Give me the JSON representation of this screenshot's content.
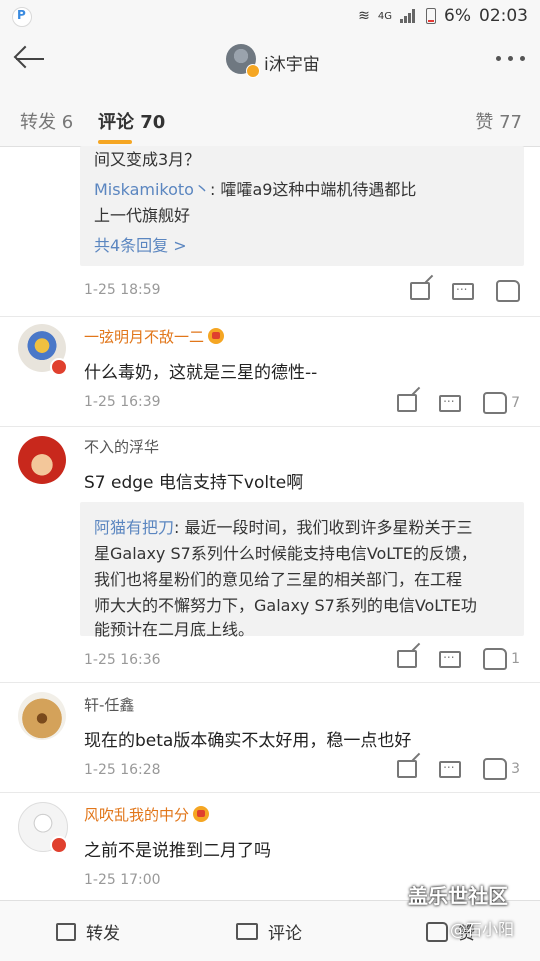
{
  "status_bar": {
    "network": "4G",
    "battery": "6%",
    "time": "02:03"
  },
  "header": {
    "title": "i沐宇宙"
  },
  "tabs": [
    {
      "label": "转发 6"
    },
    {
      "label": "评论 70"
    },
    {
      "label": "赞 77"
    }
  ],
  "comments": [
    {
      "quote_lines": [
        {
          "text": "间又变成3月？"
        },
        {
          "name": "Miskamikoto丶",
          "text": ": 嚯嚯a9这种中端机待遇都比"
        },
        {
          "text": "上一代旗舰好"
        }
      ],
      "more_replies": "共4条回复 >",
      "time": "1-25 18:59",
      "likes": ""
    },
    {
      "name": "一弦明月不敌一二",
      "name_color": "#e1761a",
      "text": "什么毒奶，这就是三星的德性--",
      "time": "1-25 16:39",
      "likes": "7"
    },
    {
      "name": "不入的浮华",
      "name_color": "#555555",
      "text": "S7 edge 电信支持下volte啊",
      "quote_lines": [
        {
          "name": "阿猫有把刀",
          "text": ": 最近一段时间，我们收到许多星粉关于三"
        },
        {
          "text": "星Galaxy S7系列什么时候能支持电信VoLTE的反馈，"
        },
        {
          "text": "我们也将星粉们的意见给了三星的相关部门，在工程"
        },
        {
          "text": "师大大的不懈努力下，Galaxy S7系列的电信VoLTE功"
        },
        {
          "text": "能预计在二月底上线。"
        }
      ],
      "time": "1-25 16:36",
      "likes": "1"
    },
    {
      "name": "轩-任鑫",
      "name_color": "#555555",
      "text": "现在的beta版本确实不太好用，稳一点也好",
      "time": "1-25 16:28",
      "likes": "3"
    },
    {
      "name": "风吹乱我的中分",
      "name_color": "#e1761a",
      "text": "之前不是说推到二月了吗",
      "time": "1-25 17:00",
      "likes": ""
    }
  ],
  "bottom_bar": {
    "share": "转发",
    "comment": "评论",
    "like": "赞"
  },
  "watermark": {
    "brand": "盖乐世社区",
    "user": "@石小阳"
  }
}
